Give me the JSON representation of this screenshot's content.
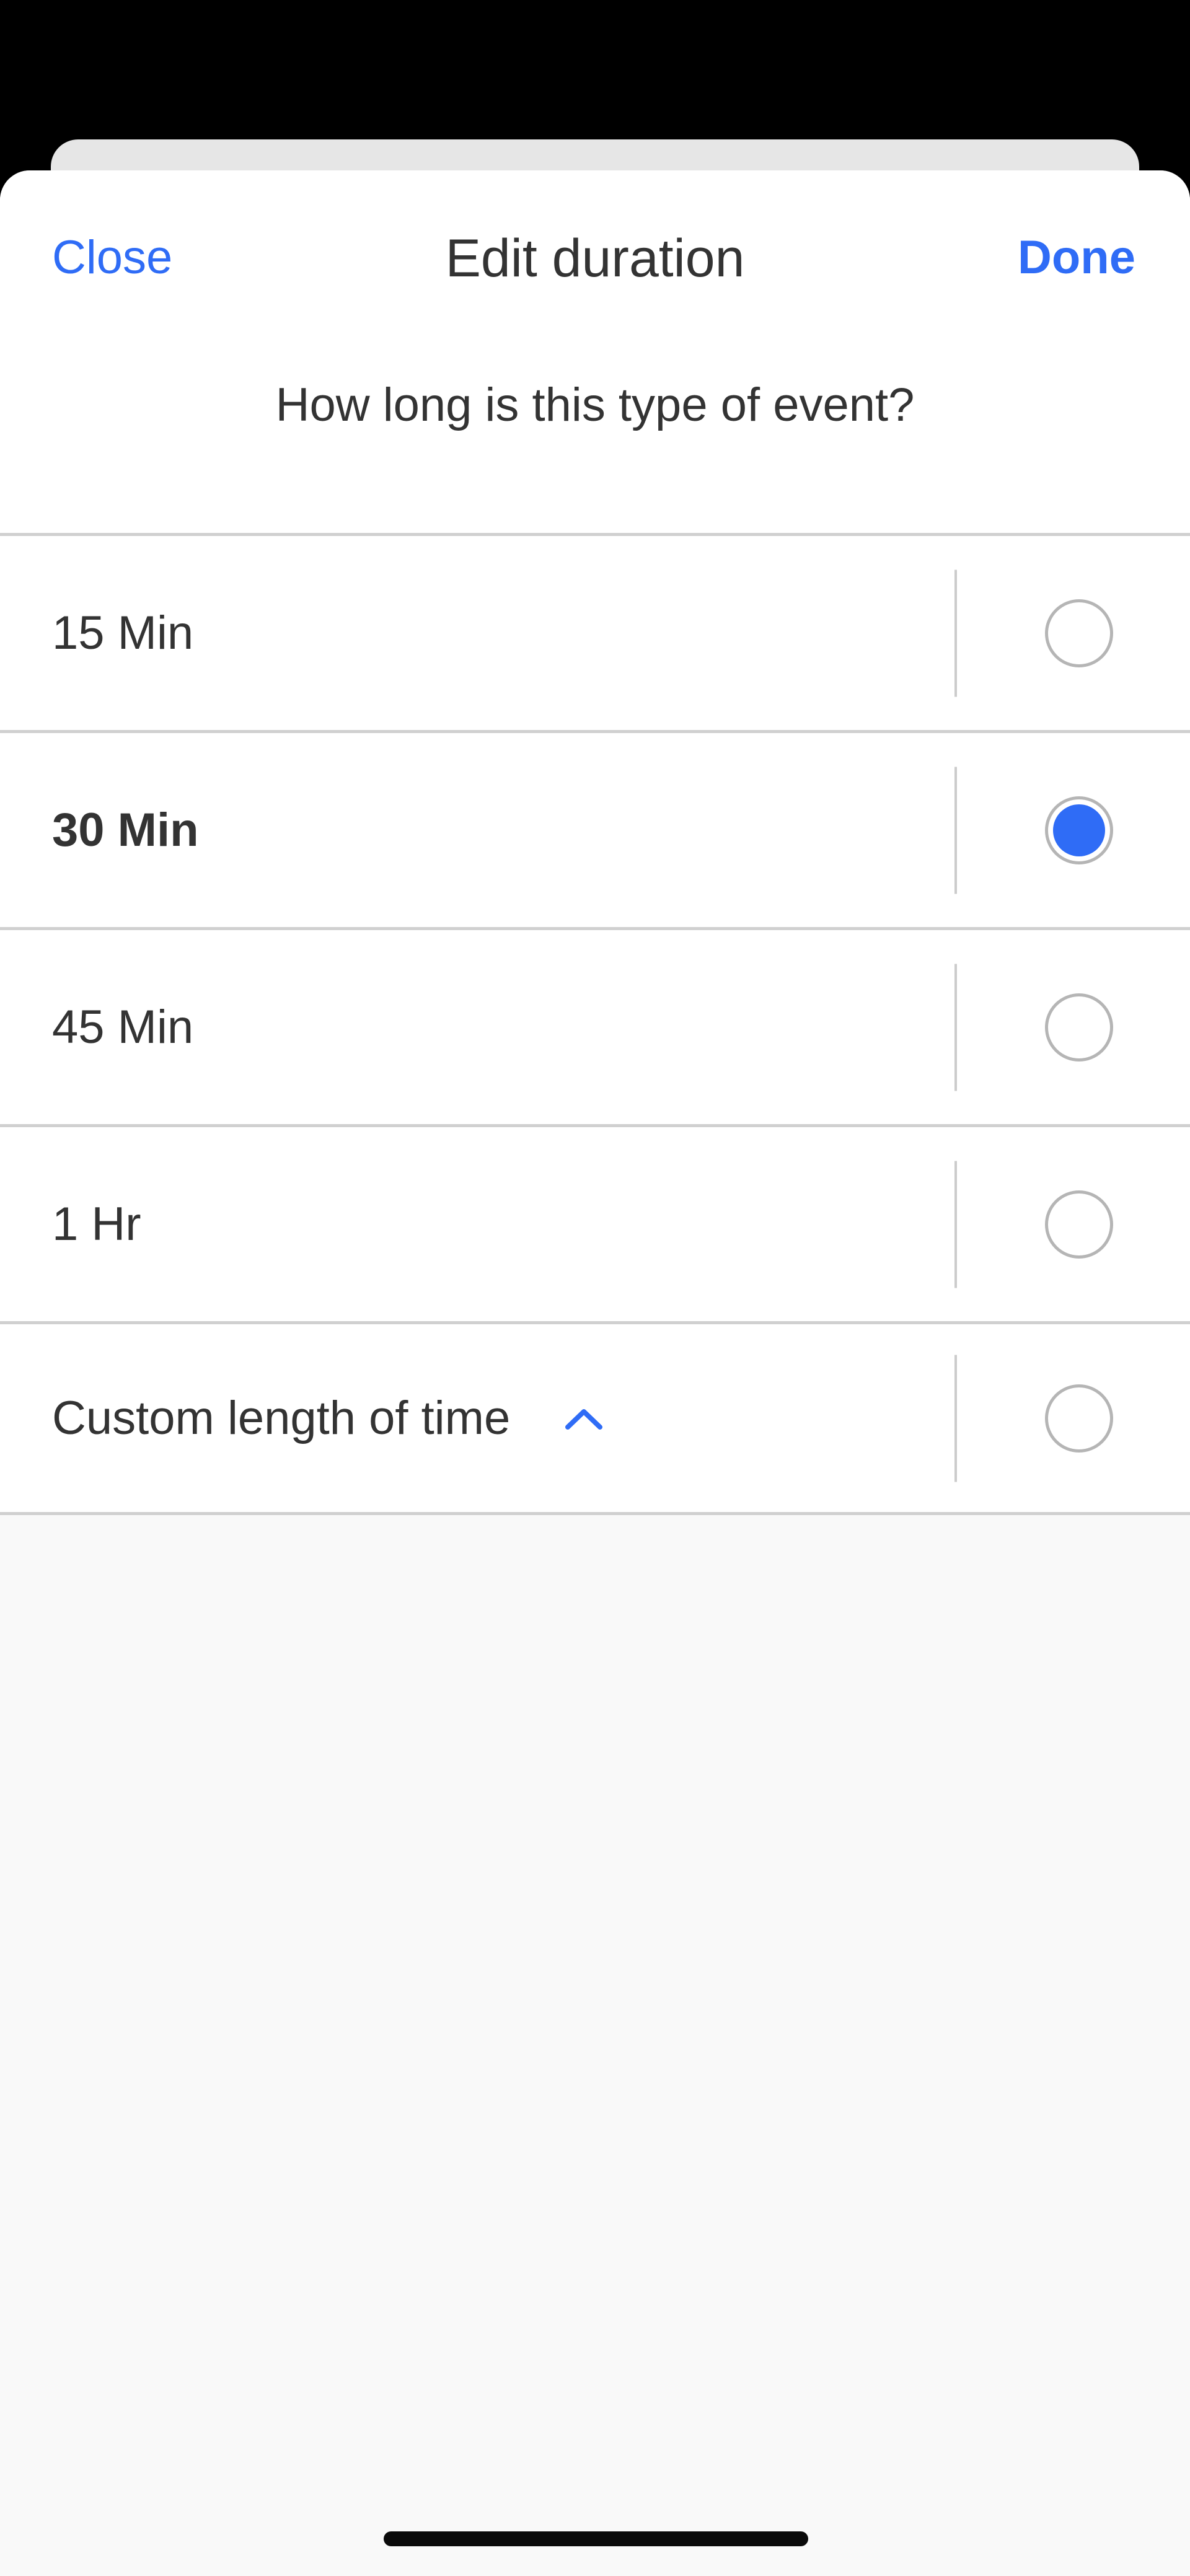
{
  "header": {
    "close_label": "Close",
    "title": "Edit duration",
    "done_label": "Done"
  },
  "question": "How long is this type of event?",
  "options": [
    {
      "label": "15 Min",
      "selected": false
    },
    {
      "label": "30 Min",
      "selected": true
    },
    {
      "label": "45 Min",
      "selected": false
    },
    {
      "label": "1 Hr",
      "selected": false
    },
    {
      "label": "Custom length of time",
      "selected": false,
      "icon": "chevron-up-icon"
    }
  ],
  "colors": {
    "accent": "#2f6cf6",
    "text": "#333333",
    "divider": "#d0d0d0",
    "background": "#f9f9f9"
  }
}
